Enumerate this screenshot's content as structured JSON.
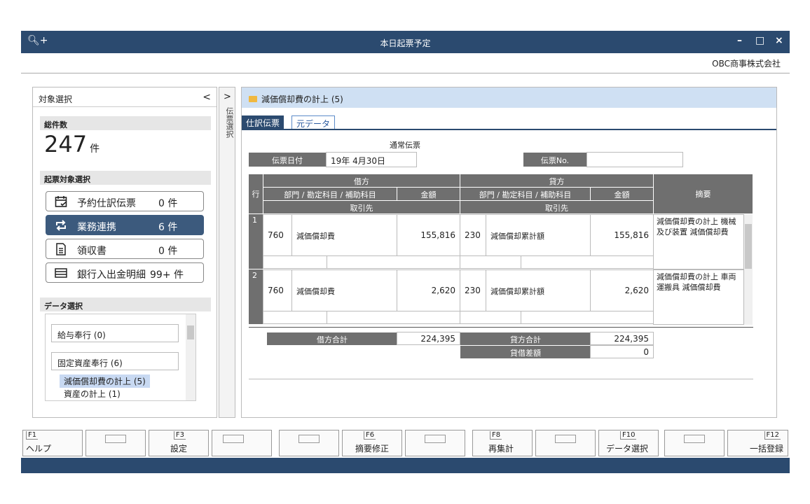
{
  "window": {
    "title": "本日起票予定",
    "company": "OBC商事株式会社",
    "zoom_icon": "zoom-in-icon",
    "minimize": "–",
    "maximize": "□",
    "close": "×"
  },
  "left": {
    "header": "対象選択",
    "collapse": "<",
    "total_label": "総件数",
    "total_count": "247",
    "total_unit": "件",
    "target_label": "起票対象選択",
    "buttons": [
      {
        "label": "予約仕訳伝票",
        "count": "0 件",
        "icon": "calendar-icon"
      },
      {
        "label": "業務連携",
        "count": "6 件",
        "icon": "sync-icon"
      },
      {
        "label": "領収書",
        "count": "0 件",
        "icon": "receipt-icon"
      },
      {
        "label": "銀行入出金明細",
        "count": "99+ 件",
        "icon": "bank-statement-icon"
      }
    ],
    "data_label": "データ選択",
    "list": [
      {
        "label": "給与奉行 (0)"
      },
      {
        "label": "固定資産奉行 (6)"
      }
    ],
    "sub_items": [
      "減価償却費の計上 (5)",
      "資産の計上 (1)"
    ]
  },
  "sidetab": {
    "arrow": ">",
    "label": "伝票選択"
  },
  "main": {
    "header": "減価償却費の計上 (5)",
    "tabs": [
      "仕訳伝票",
      "元データ"
    ],
    "voucher_type": "通常伝票",
    "date_label": "伝票日付",
    "date_value": "19年  4月30日",
    "no_label": "伝票No.",
    "no_value": "",
    "table": {
      "row_label": "行",
      "debit": "借方",
      "credit": "貸方",
      "dept_account": "部門 / 勘定科目 / 補助科目",
      "amount": "金額",
      "partner": "取引先",
      "memo": "摘要",
      "rows": [
        {
          "no": "1",
          "d_dept": "760",
          "d_account": "減価償却費",
          "d_amount": "155,816",
          "c_dept": "230",
          "c_account": "減価償却累計額",
          "c_amount": "155,816",
          "memo": "減価償却費の計上 機械及び装置 減価償却費"
        },
        {
          "no": "2",
          "d_dept": "760",
          "d_account": "減価償却費",
          "d_amount": "2,620",
          "c_dept": "230",
          "c_account": "減価償却累計額",
          "c_amount": "2,620",
          "memo": "減価償却費の計上 車両運搬具 減価償却費"
        }
      ]
    },
    "totals": {
      "debit_label": "借方合計",
      "debit_value": "224,395",
      "credit_label": "貸方合計",
      "credit_value": "224,395",
      "diff_label": "貸借差額",
      "diff_value": "0"
    }
  },
  "fkeys": [
    {
      "key": "F1",
      "label": "ヘルプ"
    },
    {
      "key": "F3",
      "label": "設定"
    },
    {
      "key": "F6",
      "label": "摘要修正"
    },
    {
      "key": "F8",
      "label": "再集計"
    },
    {
      "key": "F10",
      "label": "データ選択"
    },
    {
      "key": "F12",
      "label": "一括登録"
    }
  ]
}
